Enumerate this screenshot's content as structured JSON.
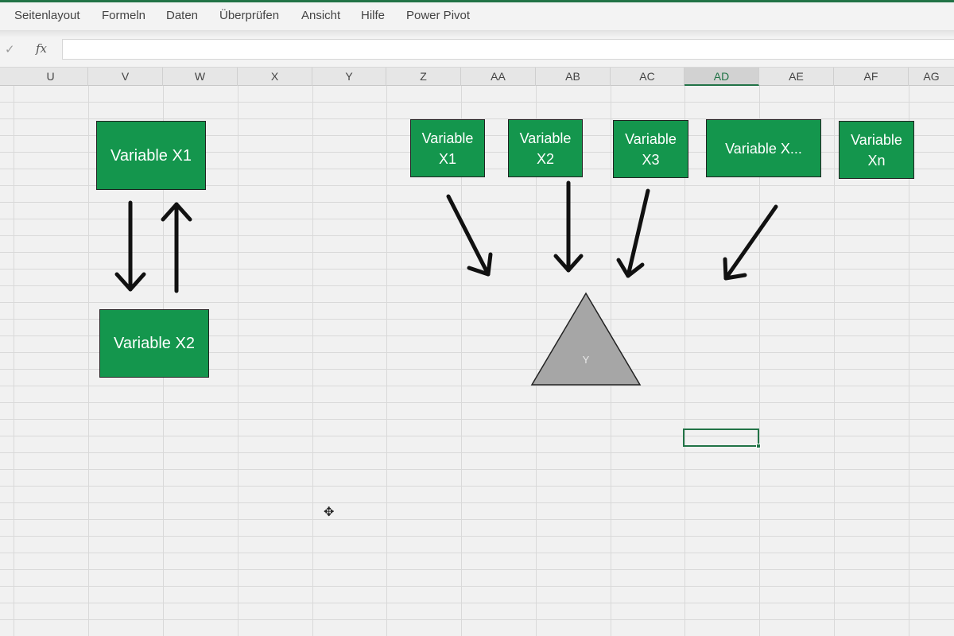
{
  "ribbon": {
    "tabs": [
      "Seitenlayout",
      "Formeln",
      "Daten",
      "Überprüfen",
      "Ansicht",
      "Hilfe",
      "Power Pivot"
    ]
  },
  "formula_bar": {
    "check_icon": "check-icon",
    "fx_label": "fx",
    "value": ""
  },
  "columns": [
    "U",
    "V",
    "W",
    "X",
    "Y",
    "Z",
    "AA",
    "AB",
    "AC",
    "AD",
    "AE",
    "AF",
    "AG"
  ],
  "selected_column": "AD",
  "left_diagram": {
    "box1": "Variable X1",
    "box2": "Variable X2"
  },
  "right_diagram": {
    "boxes": [
      "Variable\nX1",
      "Variable\nX2",
      "Variable\nX3",
      "Variable X...",
      "Variable\nXn"
    ],
    "target": "Y"
  },
  "colors": {
    "excel_green": "#217346",
    "box_fill": "#14964d",
    "triangle_fill": "#a6a6a6"
  }
}
